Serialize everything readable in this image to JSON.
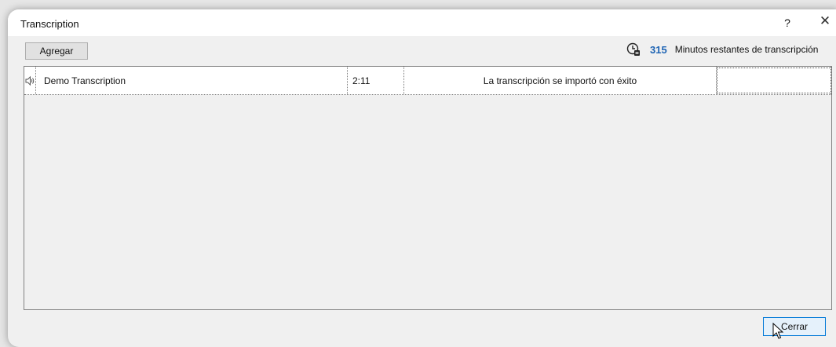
{
  "window": {
    "title": "Transcription",
    "help_label": "?",
    "close_label": "✕"
  },
  "toolbar": {
    "add_label": "Agregar",
    "minutes_count": "315",
    "minutes_label": "Minutos restantes de transcripción",
    "minutes_color": "#1e64b4"
  },
  "list": {
    "rows": [
      {
        "icon": "speaker-icon",
        "name": "Demo Transcription",
        "duration": "2:11",
        "status": "La transcripción se importó con éxito",
        "extra": ""
      }
    ]
  },
  "footer": {
    "close_label": "Cerrar",
    "accent": "#0078d7"
  }
}
